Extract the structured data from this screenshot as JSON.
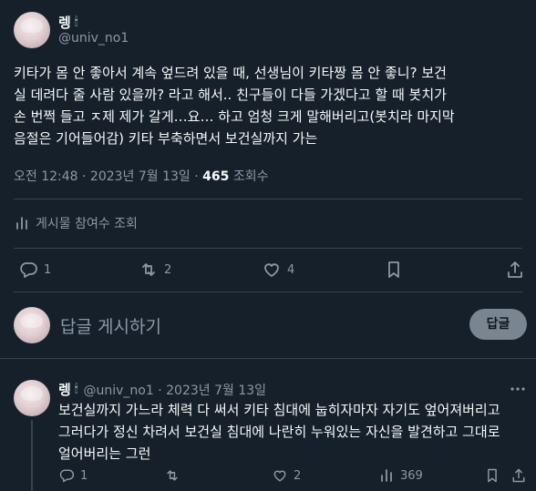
{
  "tweet": {
    "author_name": "렝",
    "author_emoji": "🕯",
    "handle": "@univ_no1",
    "lines": [
      "키타가 몸 안 좋아서 계속 엎드려 있을 때, 선생님이 키타짱 몸 안 좋니? 보건",
      "실 데려다 줄 사람 있을까? 라고 해서.. 친구들이 다들 가겠다고 할 때 봇치가",
      "손 번쩍 들고 ㅈ제 제가 갈게…요… 하고 엄청 크게 말해버리고(봇치라 마지막",
      "음절은 기어들어감) 키타 부축하면서 보건실까지 가는"
    ],
    "time": "오전 12:48 · 2023년 7월 13일 · ",
    "views_count": "465",
    "views_label": " 조회수",
    "engagement_label": "게시물 참여수 조회",
    "replies": "1",
    "reposts": "2",
    "likes": "4"
  },
  "composer": {
    "placeholder": "답글 게시하기",
    "button_label": "답글"
  },
  "reply": {
    "author_name": "렝",
    "author_emoji": "🕯",
    "handle_date": "@univ_no1 · 2023년 7월 13일",
    "lines": [
      "보건실까지 가느라 체력 다 써서 키타 침대에 눕히자마자 자기도 엎어져버리고",
      "그러다가 정신 차려서 보건실 침대에 나란히 누워있는 자신을 발견하고 그대로",
      "얼어버리는 그런"
    ],
    "replies": "1",
    "reposts": "",
    "likes": "2",
    "views": "369"
  }
}
